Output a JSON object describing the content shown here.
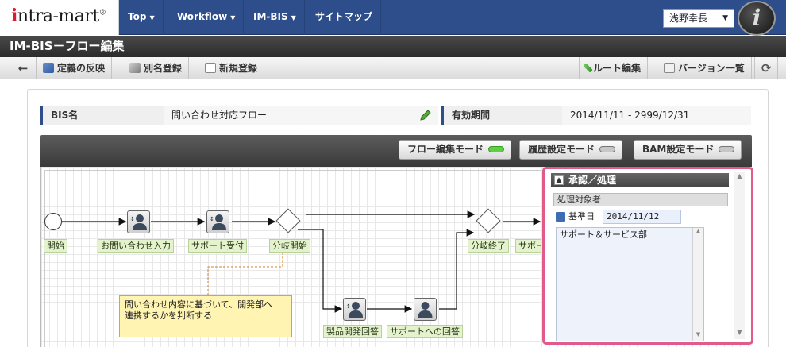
{
  "header": {
    "logo_prefix": "i",
    "logo_text": "ntra-mart",
    "logo_reg": "®",
    "nav": [
      "Top",
      "Workflow",
      "IM-BIS",
      "サイトマップ"
    ],
    "user_name": "浅野幸長",
    "avatar_letter": "i"
  },
  "page_title": "IM-BIS－フロー編集",
  "toolbar": {
    "back_icon": "←",
    "apply_label": "定義の反映",
    "alias_label": "別名登録",
    "new_label": "新規登録",
    "route_edit_label": "ルート編集",
    "version_list_label": "バージョン一覧",
    "refresh_icon": "⟳"
  },
  "info": {
    "bis_name_label": "BIS名",
    "bis_name_value": "問い合わせ対応フロー",
    "valid_period_label": "有効期間",
    "valid_period_value": "2014/11/11 - 2999/12/31"
  },
  "modes": {
    "flow_edit": "フロー編集モード",
    "history": "履歴設定モード",
    "bam": "BAM設定モード"
  },
  "flow": {
    "nodes": {
      "start": "開始",
      "inquiry_input": "お問い合わせ入力",
      "support_accept": "サポート受付",
      "branch_start": "分岐開始",
      "branch_end": "分岐終了",
      "support_cut": "サポー",
      "product_answer": "製品開発回答",
      "support_answer": "サポートへの回答"
    },
    "note_line1": "問い合わせ内容に基づいて、開発部へ",
    "note_line2": "連携するかを判断する"
  },
  "properties": {
    "header": "承認／処理",
    "subheader": "処理対象者",
    "date_label": "基準日",
    "date_value": "2014/11/12",
    "list_item": "サポート＆サービス部"
  }
}
